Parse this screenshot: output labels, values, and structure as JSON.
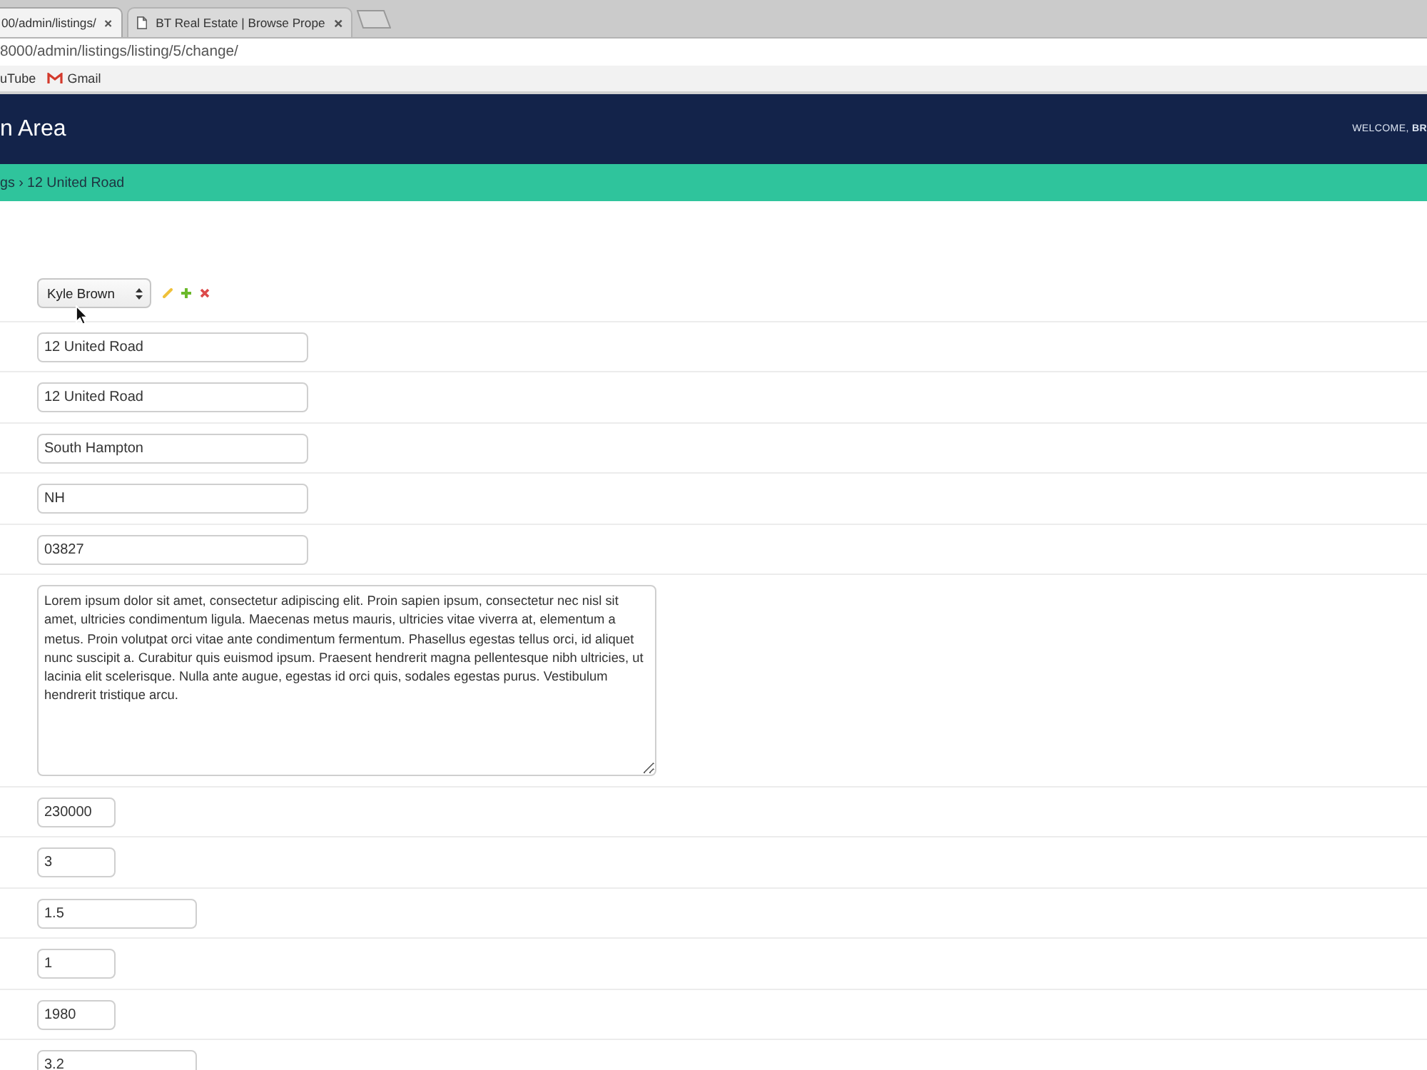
{
  "browser": {
    "tabs": [
      {
        "title": "00/admin/listings/",
        "selected": true,
        "icon": false
      },
      {
        "title": "BT Real Estate | Browse Prope",
        "selected": false,
        "icon": true
      }
    ],
    "address": "8000/admin/listings/listing/5/change/",
    "bookmarks": [
      {
        "label": "uTube",
        "kind": "plain"
      },
      {
        "label": "Gmail",
        "kind": "with_icon"
      }
    ]
  },
  "header": {
    "title": "n Area",
    "welcome": "WELCOME, **BR**"
  },
  "breadcrumb": "gs › 12 United Road",
  "fields": [
    {
      "kind": "select",
      "value": "Kyle Brown"
    },
    {
      "kind": "text",
      "value": "12 United Road"
    },
    {
      "kind": "text",
      "value": "12 United Road"
    },
    {
      "kind": "text",
      "value": "South Hampton"
    },
    {
      "kind": "text",
      "value": "NH"
    },
    {
      "kind": "text",
      "value": "03827"
    },
    {
      "kind": "textarea",
      "value": "Lorem ipsum dolor sit amet, consectetur adipiscing elit. Proin sapien ipsum, consectetur nec nisl sit amet, ultricies condimentum ligula. Maecenas metus mauris, ultricies vitae viverra at, elementum a metus. Proin volutpat orci vitae ante condimentum fermentum. Phasellus egestas tellus orci, id aliquet nunc suscipit a. Curabitur quis euismod ipsum. Praesent hendrerit magna pellentesque nibh ultricies, ut lacinia elit scelerisque. Nulla ante augue, egestas id orci quis, sodales egestas purus. Vestibulum hendrerit tristique arcu."
    },
    {
      "kind": "integer",
      "value": "230000"
    },
    {
      "kind": "integer",
      "value": "3"
    },
    {
      "kind": "decimal",
      "value": "1.5"
    },
    {
      "kind": "integer",
      "value": "1"
    },
    {
      "kind": "integer",
      "value": "1980"
    },
    {
      "kind": "decimal",
      "value": "3.2"
    }
  ]
}
